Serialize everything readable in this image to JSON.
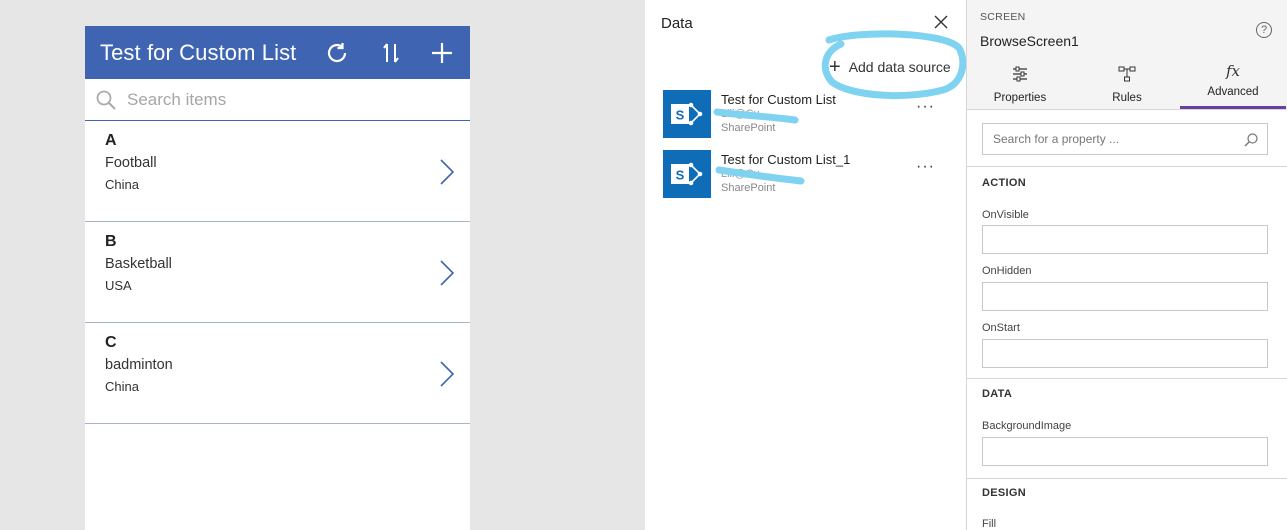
{
  "app": {
    "title": "Test for Custom List",
    "search_placeholder": "Search items",
    "items": [
      {
        "title": "A",
        "subtitle": "Football",
        "body": "China"
      },
      {
        "title": "B",
        "subtitle": "Basketball",
        "body": "USA"
      },
      {
        "title": "C",
        "subtitle": "badminton",
        "body": "China"
      }
    ]
  },
  "data_panel": {
    "title": "Data",
    "add_label": "Add data source",
    "sources": [
      {
        "name": "Test for Custom List",
        "account": "Lili@Cu",
        "type": "SharePoint"
      },
      {
        "name": "Test for Custom List_1",
        "account": "Lili@Cu",
        "type": "SharePoint"
      }
    ],
    "more_label": "···"
  },
  "properties": {
    "screen_label": "SCREEN",
    "screen_name": "BrowseScreen1",
    "help_label": "?",
    "tabs": [
      {
        "label": "Properties"
      },
      {
        "label": "Rules"
      },
      {
        "label": "Advanced",
        "icon_text": "fx"
      }
    ],
    "search_placeholder": "Search for a property ...",
    "sections": {
      "action": "ACTION",
      "data": "DATA",
      "design": "DESIGN"
    },
    "fields": {
      "onvisible": "OnVisible",
      "onhidden": "OnHidden",
      "onstart": "OnStart",
      "backgroundimage": "BackgroundImage",
      "fill": "Fill"
    }
  },
  "colors": {
    "header": "#3f64b2",
    "sharepoint": "#0f6cb6",
    "annotation": "#7fd3f0",
    "active_tab": "#6b3fa0"
  }
}
